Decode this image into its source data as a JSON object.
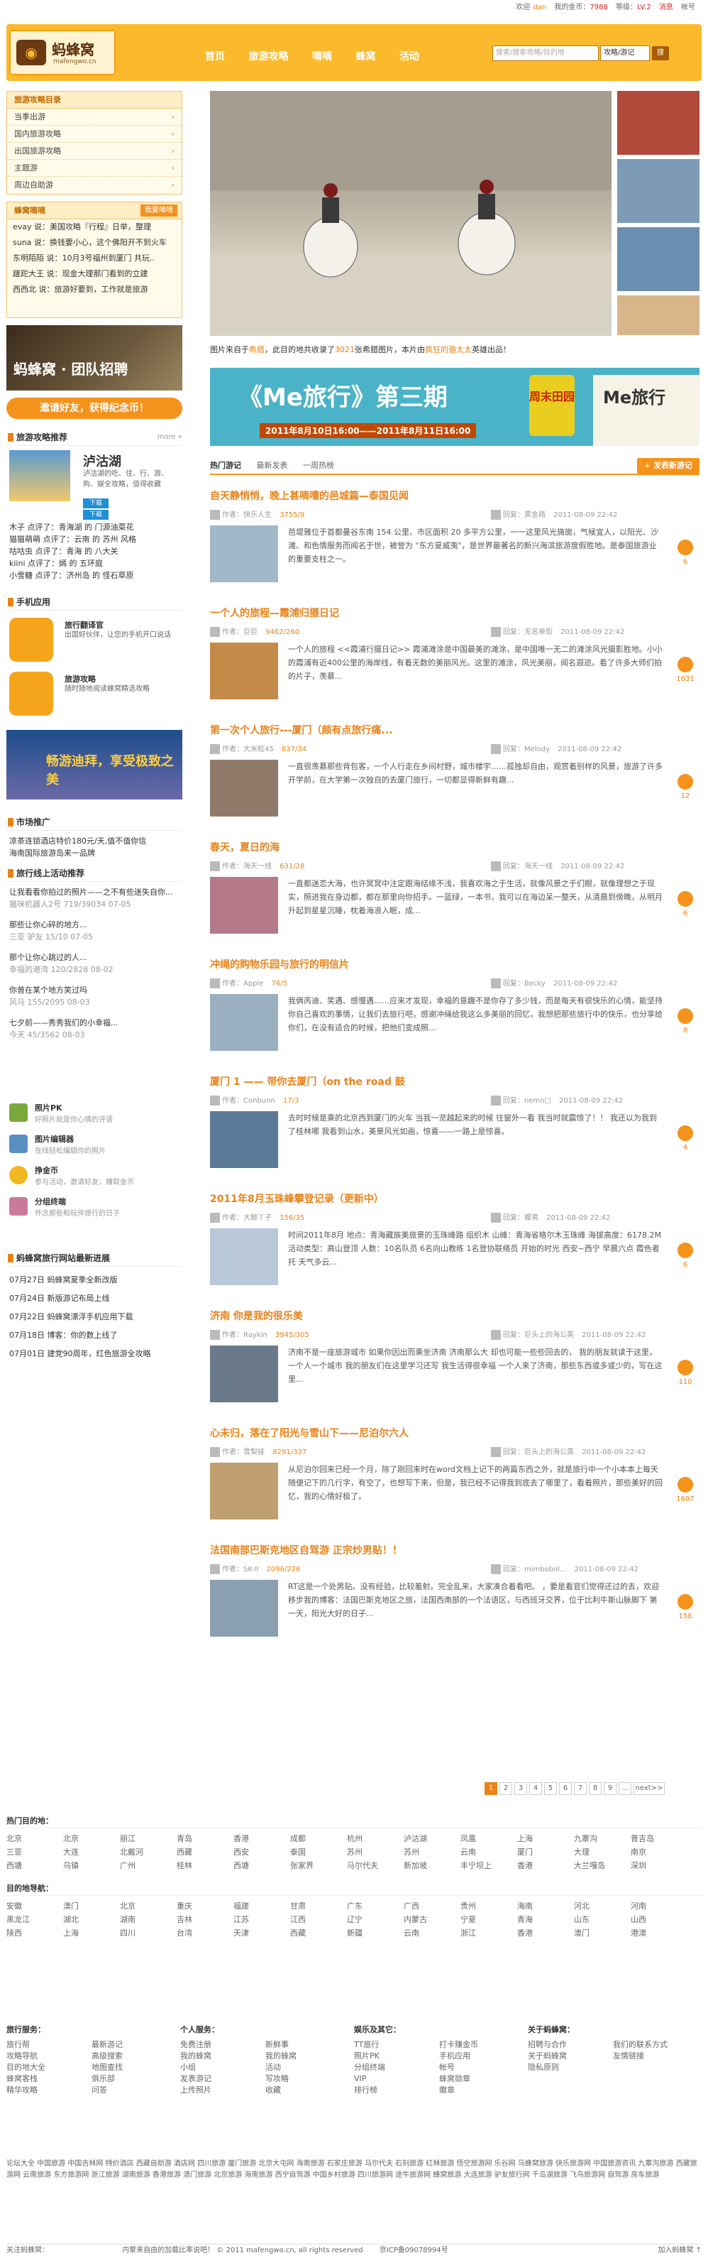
{
  "topbar": {
    "login_label": "欢迎",
    "user": "dan",
    "coins_label": "我的金币：",
    "coins": "7988",
    "level_label": "等级：",
    "level": "LV.2",
    "messages": "消息",
    "account": "帐号"
  },
  "logo": {
    "name": "蚂蜂窝",
    "url": "mafengwo.cn"
  },
  "nav": [
    "首页",
    "旅游攻略",
    "嘀嘀",
    "蜂窝",
    "活动"
  ],
  "search": {
    "placeholder": "搜索/搜索攻略/目的地",
    "type": "攻略/游记",
    "button": "搜"
  },
  "guides": {
    "title": "旅游攻略目录",
    "items": [
      "当季出游",
      "国内旅游攻略",
      "出国旅游攻略",
      "主题游",
      "周边自助游"
    ]
  },
  "feed": {
    "title": "蜂窝嘀嘀",
    "button": "我要嘀嘀",
    "items": [
      "evay 说：美国攻略『行程』日举，整理",
      "suna 说：换钱要小心，这个佛阳开不到火车",
      "东明陌陌 说：10月3号福州到厦门 共玩..",
      "蹉跎大王 说：现金大理那门看到的立建",
      "西西北 说：旅游好要到，工作就是旅游"
    ]
  },
  "banner": "蚂蜂窝 · 团队招聘",
  "invite": "邀请好友，获得纪念币！",
  "guide_rec": {
    "title": "旅游攻略推荐",
    "more": "more »",
    "name": "泸沽湖",
    "desc": "泸沽湖的吃、住、行、游、购、娱全攻略，值得收藏",
    "btn1": "下载",
    "btn2": "下载"
  },
  "comments": [
    "木子 点评了：青海湖 的 门源油菜花",
    "猫猫萌萌 点评了：云南 的 苏州 风格",
    "咕咕虫 点评了：青海 的 八大关",
    "kiini 点评了：嫣 的 五环庭",
    "小雪糖 点评了：济州岛 的 怪石草原"
  ],
  "mobile": {
    "title": "手机应用",
    "app1_name": "旅行翻译官",
    "app1_desc": "出国好伙伴，让您的手机开口说话",
    "app2_name": "旅游攻略",
    "app2_desc": "随时随地阅读蜂窝精选攻略"
  },
  "dubai": "畅游迪拜，享受极致之美",
  "market": {
    "title": "市场推广",
    "items": [
      "凉茶连锁酒店特价180元/天,值不值你信",
      "海南国际旅游岛来一品牌"
    ]
  },
  "route": {
    "title": "旅行线上活动推荐",
    "items": [
      "让我看看你拍过的照片——之不有些迷失自你...",
      "猫咪机器人2号  719/39034  07-05",
      "那些让你心碎的地方...",
      "三亚  驴友  15/10  07-05",
      "那个让你心跳过的人...",
      "幸福的港湾  120/2828  08-02",
      "你曾在某个地方笑过吗",
      "风马  155/2095  08-03",
      "七夕前——秀秀我们的小幸福...",
      "今天  45/3562  08-03"
    ]
  },
  "features": [
    {
      "name": "照片PK",
      "desc": "好照片就是你心情的评语"
    },
    {
      "name": "图片编辑器",
      "desc": "在线轻松编辑你的照片"
    },
    {
      "name": "挣金币",
      "desc": "参与活动，邀请好友，赚取金币"
    },
    {
      "name": "分组终端",
      "desc": "怀念那些和玩伴旅行的日子"
    }
  ],
  "updates": {
    "title": "蚂蜂窝旅行网站最新进展",
    "items": [
      "07月27日 蚂蜂窝夏季全新改版",
      "07月24日 新版游记布局上线",
      "07月22日 蚂蜂窝漂浮手机应用下载",
      "07月18日 博客：你的数上线了",
      "07月01日 建党90周年，红色旅游全攻略"
    ]
  },
  "hero_caption": {
    "prefix": "图片来自于",
    "place": "希腊",
    "mid": "，此目的地共收录了",
    "count": "3021",
    "mid2": "张希腊图片，本片由",
    "author": "疯狂的骆太太",
    "suffix": "英雄出品！"
  },
  "me_banner": {
    "title": "《Me旅行》第三期",
    "dates": "2011年8月10日16:00——2011年8月11日16:00",
    "badge": "周末田园",
    "logo": "Me旅行"
  },
  "tabs": [
    "热门游记",
    "最新发表",
    "一周热榜"
  ],
  "publish": "+ 发表新游记",
  "posts": [
    {
      "title": "自天静悄悄，晚上甚嘀嘈的邑城篇—泰国见闻",
      "author": "作者：快乐人生",
      "stat": "3755/9",
      "reply_user": "回复：黄金路",
      "date": "2011-08-09 22:42",
      "text": "芭堤雅位于首都曼谷东南 154 公里、市区面积 20 多平方公里，一一这里风光旖旎，气候宜人，以阳光、沙滩、和色情服务而闻名于世，被誉为 \"东方夏威夷\"，是世界最著名的新兴海滨旅游度假胜地。是泰国旅游业的重要支柱之一。",
      "count": "6"
    },
    {
      "title": "一个人的旅程—霞浦归摄日记",
      "author": "作者：巨巨",
      "stat": "9462/260",
      "reply_user": "回复：无名单街",
      "date": "2011-08-09 22:42",
      "text": "一个人的旅程 <<霞浦行摄日记>> 霞浦滩涂是中国最美的滩涂，是中国唯一无二的滩涂风光摄影胜地。小小的霞浦有近400公里的海岸线，有着无数的美丽风光。这里的滩涂，风光美丽，闻名遐迩。看了许多大师们拍的片子，羡慕...",
      "count": "1631"
    },
    {
      "title": "第一次个人旅行---厦门（颇有点旅行痛...",
      "author": "作者：大米粒45",
      "stat": "837/34",
      "reply_user": "回复：Melody",
      "date": "2011-08-09 22:42",
      "text": "一直很羡慕那些背包客，一个人行走在乡间村野，城市楼宇……孤独却自由，观赏着别样的风景，旅游了许多开学前，在大学第一次独自的去厦门旅行，一切都显得新鲜有趣...",
      "count": "12"
    },
    {
      "title": "春天，夏日的海",
      "author": "作者：海天一线",
      "stat": "631/28",
      "reply_user": "回复：海天一线",
      "date": "2011-08-09 22:42",
      "text": "一直都迷恋大海，也许冥冥中注定跟海结缘不浅，我喜欢海之于生活，就像风景之于们眼，就像理想之于现实，照进我在身边都，都在那里向你招手。一蓝绿，一本书，我可以在海边呆一整天，从清晨到傍晚，从明月升起到星星沉睡，枕着海浪入眠，成...",
      "count": "6"
    },
    {
      "title": "冲绳的购物乐园与旅行的明信片",
      "author": "作者：Apple",
      "stat": "76/5",
      "reply_user": "回复：Becky",
      "date": "2011-08-09 22:42",
      "text": "我俩芮迪、笑遇、感慢遇……应来才发现，幸福的意趣不是你存了多少钱，而是每天有很快乐的心情，能坚持你自己喜欢的事情，让我们去旅行吧，感谢冲绳给我这么多美丽的回忆，我想把那些旅行中的快乐，也分享给你们，在没有适合的时候，把他们变成照...",
      "count": "8"
    },
    {
      "title": "厦门 1 —— 带你去厦门（on the road 鼓",
      "author": "作者：Conbunn",
      "stat": "17/3",
      "reply_user": "回复：nemo□",
      "date": "2011-08-09 22:42",
      "text": "去时时候是乘的北京西到厦门的火车 当我一览越起来的时候 往窗外一看 我当时就震惊了！！ 我还以为我到了桂林哪 我看到山水，美景风光如画，惊喜——一路上是惊喜。",
      "count": "4"
    },
    {
      "title": "2011年8月玉珠峰攀登记录（更新中）",
      "author": "作者：大脚丫子",
      "stat": "156/35",
      "reply_user": "回复：蝶焉",
      "date": "2011-08-09 22:42",
      "text": "时间2011年8月 地点：青海藏族美旅景的玉珠峰路 组织木 山峰：青海省格尔木玉珠峰 海拔高度：6178.2M 活动类型：高山登顶 人数：10名队员 6名向山教练 1名登协联络员 开始的时光 西安~西宁 早晨六点 霞色者托 天气多云...",
      "count": "6"
    },
    {
      "title": "济南 你是我的很乐美",
      "author": "作者：Raykin",
      "stat": "3945/305",
      "reply_user": "回复：巨头上的海公英",
      "date": "2011-08-09 22:42",
      "text": "济南不是一座旅游城市 如果你因出而乘坐济南 济南那么大 却也可能一些些回去的， 我的朋友就读于这里，一个人一个城市 我的朋友们在这里学习还写 我生活得很幸福 一个人来了济南，那些东西或多或少的，写在这里...",
      "count": "110"
    },
    {
      "title": "心未归，落在了阳光与雪山下——尼泊尔六人",
      "author": "作者：雪梨娃",
      "stat": "8291/337",
      "reply_user": "回复：巨头上的海公英",
      "date": "2011-08-09 22:42",
      "text": "从尼泊尔回来已经一个月，除了刚回来时在word文档上记下的两篇东西之外，就是旅行中一个小本本上每天随便记下的几行字，有空了，也想写下来，但是，我已经不记得我到底去了哪里了，看着照片，那些美好的回忆，我的心情好极了。",
      "count": "1697"
    },
    {
      "title": "法国南部巴斯克地区自驾游 正宗炒男贴！！",
      "author": "作者：SK-II",
      "stat": "2096/226",
      "reply_user": "回复：mimbobol...",
      "date": "2011-08-09 22:42",
      "text": "RT这是一个处男贴。没有经验，比较羞射。完全乱来，大家凑合着看吧。 ，要是看官们觉得还过的去，欢迎移步我的博客：法国巴斯克地区之旅，法国西南部的一个法语区，与西班牙交界，位于比利牛斯山脉脚下 第一天，阳光大好的日子...",
      "count": "158"
    }
  ],
  "pager": [
    "1",
    "2",
    "3",
    "4",
    "5",
    "6",
    "7",
    "8",
    "9",
    "...",
    "next>>"
  ],
  "hot_dest": {
    "title": "热门目的地：",
    "items": [
      "北京",
      "北京",
      "丽江",
      "青岛",
      "香港",
      "成都",
      "杭州",
      "泸沽湖",
      "凤凰",
      "上海",
      "九寨沟",
      "普吉岛",
      "三亚",
      "大连",
      "北戴河",
      "西藏",
      "西安",
      "泰国",
      "苏州",
      "苏州",
      "云南",
      "厦门",
      "大理",
      "南京",
      "西塘",
      "乌镇",
      "广州",
      "桂林",
      "西塘",
      "张家界",
      "马尔代夫",
      "新加坡",
      "丰宁坝上",
      "香港",
      "大兰嘎岛",
      "深圳"
    ]
  },
  "regions": {
    "title": "目的地导航：",
    "items": [
      "安徽",
      "澳门",
      "北京",
      "重庆",
      "福建",
      "甘肃",
      "广东",
      "广西",
      "贵州",
      "海南",
      "河北",
      "河南",
      "黑龙江",
      "湖北",
      "湖南",
      "吉林",
      "江苏",
      "江西",
      "辽宁",
      "内蒙古",
      "宁夏",
      "青海",
      "山东",
      "山西",
      "陕西",
      "上海",
      "四川",
      "台湾",
      "天津",
      "西藏",
      "新疆",
      "云南",
      "浙江",
      "香港",
      "澳门",
      "港澳"
    ]
  },
  "footer_cols": [
    {
      "title": "旅行服务：",
      "items": [
        "旅行帮",
        "最新游记",
        "攻略导航",
        "高级搜索",
        "目的地大全",
        "地图查找",
        "蜂窝客栈",
        "俱乐部",
        "精华攻略",
        "问答"
      ]
    },
    {
      "title": "个人服务：",
      "items": [
        "免费注册",
        "新鲜事",
        "我的蜂窝",
        "我的蜂窝",
        "小组",
        "活动",
        "发表游记",
        "写攻略",
        "上传照片",
        "收藏"
      ]
    },
    {
      "title": "娱乐及其它：",
      "items": [
        "TT旅行",
        "打卡赚金币",
        "照片PK",
        "手机应用",
        "分组终端",
        "帐号",
        "VIP",
        "蜂窝勋章",
        "排行榜",
        "徽章"
      ]
    },
    {
      "title": "关于蚂蜂窝：",
      "items": [
        "招聘与合作",
        "我们的联系方式",
        "关于蚂蜂窝",
        "友情链接",
        "隐私原则"
      ]
    }
  ],
  "partners": "论坛大全 中国旅游 中国吉林网 特价酒店 西藏自助游 酒店网 四川旅游 厦门旅游 北京大屯网 海南旅游 石家庄旅游 马尔代夫 石刻旅游 红林旅游 悟空旅游网 乐谷网 马蜂窝旅游 快乐旅游网 中国旅游资讯 九寨沟旅游 西藏旅游网 云南旅游 东方旅游网 浙江旅游 湖南旅游 香港旅游 澳门旅游 北京旅游 海南旅游 西宁自驾游 中国乡村旅游 四川旅游网 途牛旅游网 蜂窝旅游 大连旅游 驴友旅行网 千岛湖旅游 飞鸟旅游网 自驾游 房车旅游",
  "bottom": {
    "left": "关注蚂蜂窝：",
    "copyright": "内蒙来自由的加载比率说吧！  © 2011 mafengwo.cn, all rights reserved",
    "icp": "京ICP备09078994号",
    "right": "加入蚂蜂窝 ↑"
  }
}
